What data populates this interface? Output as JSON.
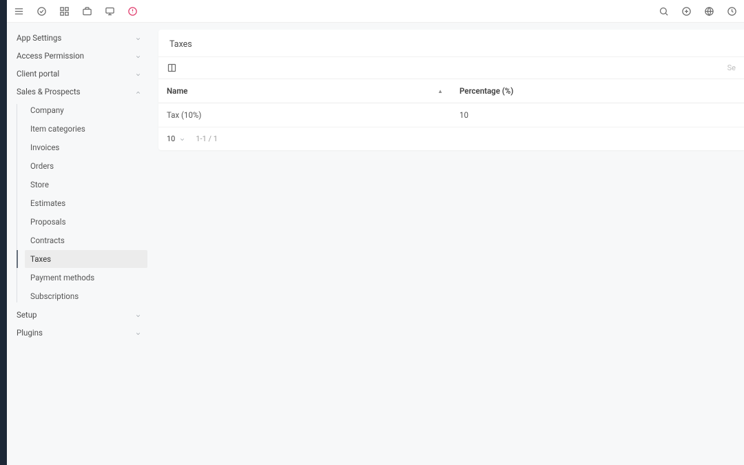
{
  "topbar": {
    "left_icons": [
      "menu",
      "check-circle",
      "grid",
      "briefcase",
      "monitor",
      "clock-alert"
    ],
    "right_icons": [
      "search",
      "plus-circle",
      "globe",
      "clock"
    ]
  },
  "sidebar": {
    "groups": [
      {
        "label": "App Settings",
        "expanded": false
      },
      {
        "label": "Access Permission",
        "expanded": false
      },
      {
        "label": "Client portal",
        "expanded": false
      },
      {
        "label": "Sales & Prospects",
        "expanded": true,
        "children": [
          "Company",
          "Item categories",
          "Invoices",
          "Orders",
          "Store",
          "Estimates",
          "Proposals",
          "Contracts",
          "Taxes",
          "Payment methods",
          "Subscriptions"
        ],
        "active": "Taxes"
      },
      {
        "label": "Setup",
        "expanded": false
      },
      {
        "label": "Plugins",
        "expanded": false
      }
    ]
  },
  "page": {
    "title": "Taxes",
    "search_hint": "Se",
    "table": {
      "columns": [
        {
          "key": "name",
          "label": "Name",
          "sort": "asc"
        },
        {
          "key": "pct",
          "label": "Percentage (%)"
        }
      ],
      "rows": [
        {
          "name": "Tax (10%)",
          "pct": "10"
        }
      ]
    },
    "pagination": {
      "page_size": "10",
      "range": "1-1 / 1"
    }
  }
}
